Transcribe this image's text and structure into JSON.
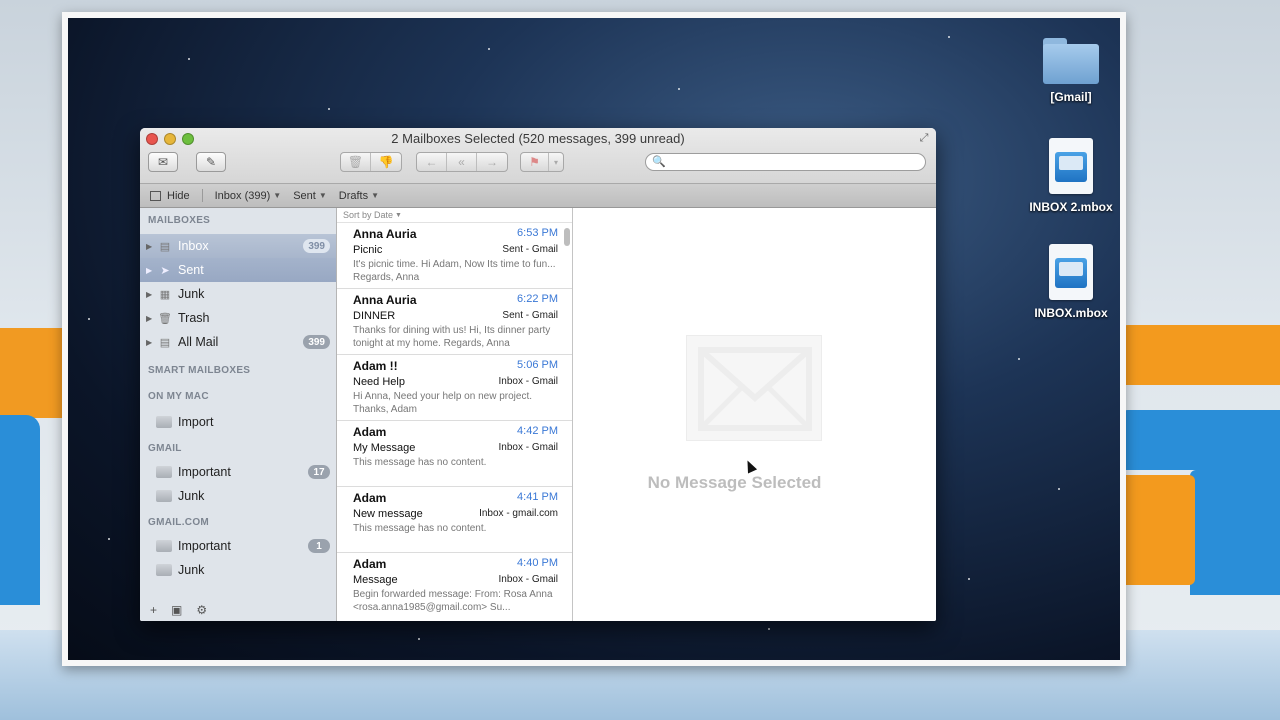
{
  "window": {
    "title": "2 Mailboxes Selected (520 messages, 399 unread)"
  },
  "toolbar": {
    "get_mail_icon": "envelope-icon",
    "compose_icon": "compose-icon",
    "search_placeholder": ""
  },
  "favorites": {
    "hide_label": "Hide",
    "inbox_label": "Inbox (399)",
    "sent_label": "Sent",
    "drafts_label": "Drafts"
  },
  "sidebar": {
    "headers": {
      "mailboxes": "MAILBOXES",
      "smart": "SMART MAILBOXES",
      "on_my_mac": "ON MY MAC",
      "gmail": "GMAIL",
      "gmail_com": "GMAIL.COM"
    },
    "mailboxes": [
      {
        "label": "Inbox",
        "badge": "399"
      },
      {
        "label": "Sent",
        "badge": ""
      },
      {
        "label": "Junk",
        "badge": ""
      },
      {
        "label": "Trash",
        "badge": ""
      },
      {
        "label": "All Mail",
        "badge": "399"
      }
    ],
    "on_my_mac": [
      {
        "label": "Import"
      }
    ],
    "gmail": [
      {
        "label": "Important",
        "badge": "17"
      },
      {
        "label": "Junk",
        "badge": ""
      }
    ],
    "gmail_com": [
      {
        "label": "Important",
        "badge": "1"
      },
      {
        "label": "Junk",
        "badge": ""
      }
    ],
    "footer": {
      "add": "+",
      "gear": "⚙"
    }
  },
  "list": {
    "sort_label": "Sort by Date",
    "messages": [
      {
        "sender": "Anna Auria",
        "time": "6:53 PM",
        "subject": "Picnic",
        "mailbox": "Sent - Gmail",
        "preview": "It's picnic time. Hi Adam, Now Its time to fun... Regards, Anna"
      },
      {
        "sender": "Anna Auria",
        "time": "6:22 PM",
        "subject": "DINNER",
        "mailbox": "Sent - Gmail",
        "preview": "Thanks for dining with us! Hi, Its dinner party tonight at my home. Regards, Anna"
      },
      {
        "sender": "Adam !!",
        "time": "5:06 PM",
        "subject": "Need Help",
        "mailbox": "Inbox - Gmail",
        "preview": "Hi Anna, Need your help on new project. Thanks, Adam"
      },
      {
        "sender": "Adam",
        "time": "4:42 PM",
        "subject": "My Message",
        "mailbox": "Inbox - Gmail",
        "preview": "This message has no content."
      },
      {
        "sender": "Adam",
        "time": "4:41 PM",
        "subject": "New message",
        "mailbox": "Inbox - gmail.com",
        "preview": "This message has no content."
      },
      {
        "sender": "Adam",
        "time": "4:40 PM",
        "subject": "Message",
        "mailbox": "Inbox - Gmail",
        "preview": "Begin forwarded message: From: Rosa Anna <rosa.anna1985@gmail.com> Su..."
      }
    ]
  },
  "viewer": {
    "empty_text": "No Message Selected"
  },
  "desktop": {
    "icons": [
      {
        "label": "[Gmail]"
      },
      {
        "label": "INBOX 2.mbox"
      },
      {
        "label": "INBOX.mbox"
      }
    ]
  }
}
